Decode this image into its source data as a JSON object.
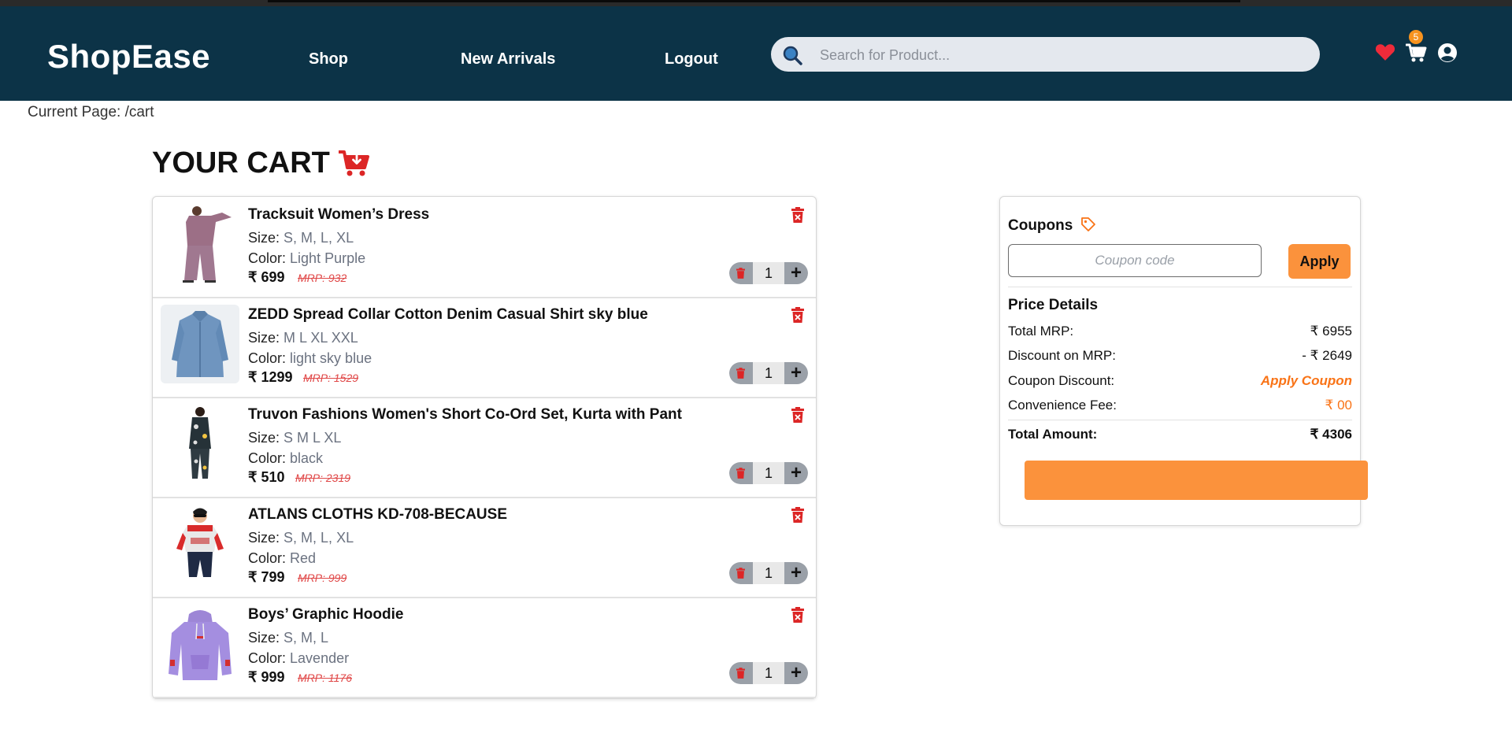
{
  "header": {
    "logo": "ShopEase",
    "nav": [
      "Shop",
      "New Arrivals",
      "Logout"
    ],
    "search_placeholder": "Search for Product...",
    "cart_count": "5",
    "icons": [
      "heart-icon",
      "cart-icon",
      "user-icon"
    ]
  },
  "breadcrumb": {
    "label": "Current Page:",
    "path": "/cart"
  },
  "cart": {
    "title": "YOUR CART",
    "size_label": "Size:",
    "color_label": "Color:",
    "items": [
      {
        "name": "Tracksuit Women’s Dress",
        "size": "S, M, L, XL",
        "color": "Light Purple",
        "price": "₹ 699",
        "mrp": "MRP: 932",
        "qty": "1"
      },
      {
        "name": "ZEDD Spread Collar Cotton Denim Casual Shirt sky blue",
        "size": "M L XL XXL",
        "color": "light sky blue",
        "price": "₹ 1299",
        "mrp": "MRP: 1529",
        "qty": "1"
      },
      {
        "name": "Truvon Fashions Women's Short Co-Ord Set, Kurta with Pant",
        "size": "S M L XL",
        "color": "black",
        "price": "₹ 510",
        "mrp": "MRP: 2319",
        "qty": "1"
      },
      {
        "name": "ATLANS CLOTHS KD-708-BECAUSE",
        "size": "S, M, L, XL",
        "color": "Red",
        "price": "₹ 799",
        "mrp": "MRP: 999",
        "qty": "1"
      },
      {
        "name": "Boys’ Graphic Hoodie",
        "size": "S, M, L",
        "color": "Lavender",
        "price": "₹ 999",
        "mrp": "MRP: 1176",
        "qty": "1"
      }
    ]
  },
  "summary": {
    "coupons_title": "Coupons",
    "coupon_placeholder": "Coupon code",
    "apply_label": "Apply",
    "price_details_title": "Price Details",
    "rows": [
      {
        "label": "Total MRP:",
        "value": "₹ 6955"
      },
      {
        "label": "Discount on MRP:",
        "value": "- ₹ 2649"
      },
      {
        "label": "Coupon Discount:",
        "value": "Apply Coupon"
      },
      {
        "label": "Convenience Fee:",
        "value": "₹ 00"
      }
    ],
    "total_label": "Total Amount:",
    "total_value": "₹ 4306"
  },
  "colors": {
    "header_bg": "#0c3347",
    "accent_orange": "#fb923c",
    "delete_red": "#dc2626",
    "mrp_red": "#e04848"
  }
}
